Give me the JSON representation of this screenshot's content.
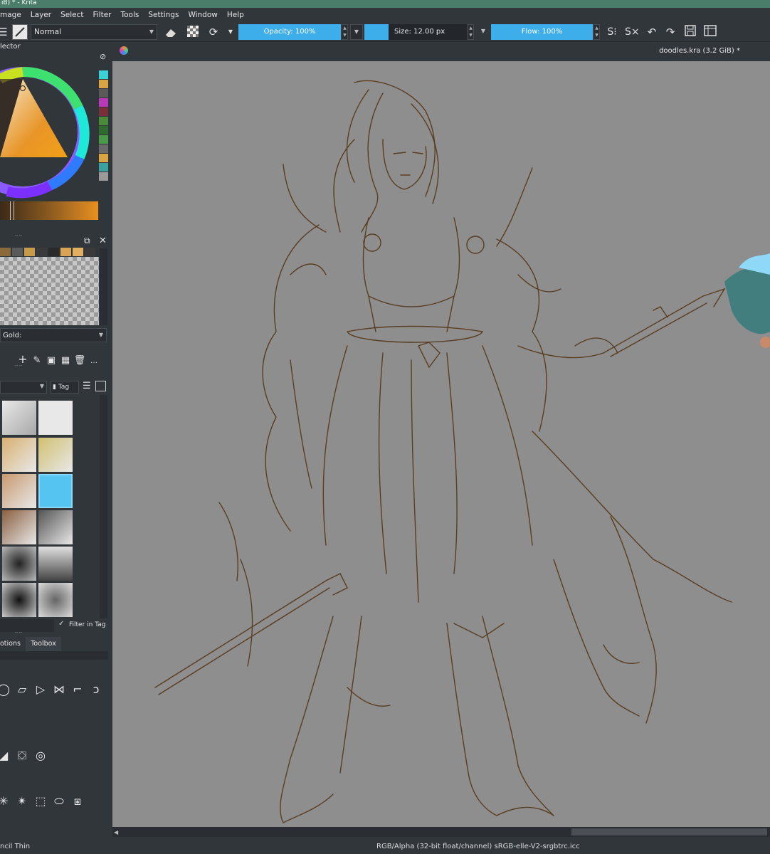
{
  "window": {
    "title": "iB) * - Krita"
  },
  "menu": [
    "mage",
    "Layer",
    "Select",
    "Filter",
    "Tools",
    "Settings",
    "Window",
    "Help"
  ],
  "toolbar": {
    "blend_mode": "Normal",
    "opacity": "Opacity: 100%",
    "size": "Size: 12.00 px",
    "flow": "Flow: 100%"
  },
  "color_selector": {
    "title": "lector",
    "swatches": [
      "#3ad2d7",
      "#d8a444",
      "#5a5a5a",
      "#b73ab8",
      "#7a2e3a",
      "#4a8a3a",
      "#2f6a2f",
      "#4a9a4a",
      "#6a6a6a",
      "#d8a444",
      "#3aa0a0",
      "#9a9a9a"
    ]
  },
  "palette": {
    "swatches": [
      "#8a6a3a",
      "#5a5a5a",
      "#c89a4a",
      "#3a3a3a",
      "#2a2a2a",
      "#d8a454",
      "#e0b060",
      "#3a3a3a"
    ],
    "name": "Gold:"
  },
  "brush_presets": {
    "tag_label": "Tag",
    "filter_label": "Filter in Tag"
  },
  "dock_tabs": [
    "otions",
    "Toolbox"
  ],
  "document": {
    "title": "doodles.kra (3.2 GiB) *"
  },
  "status": {
    "brush": "ncil Thin",
    "color_info": "RGB/Alpha (32-bit float/channel)  sRGB-elle-V2-srgbtrc.icc"
  },
  "colors": {
    "accent": "#3daee9",
    "canvas": "#8e8e8e",
    "sketch": "#5a3e22",
    "panel": "#31363b"
  }
}
